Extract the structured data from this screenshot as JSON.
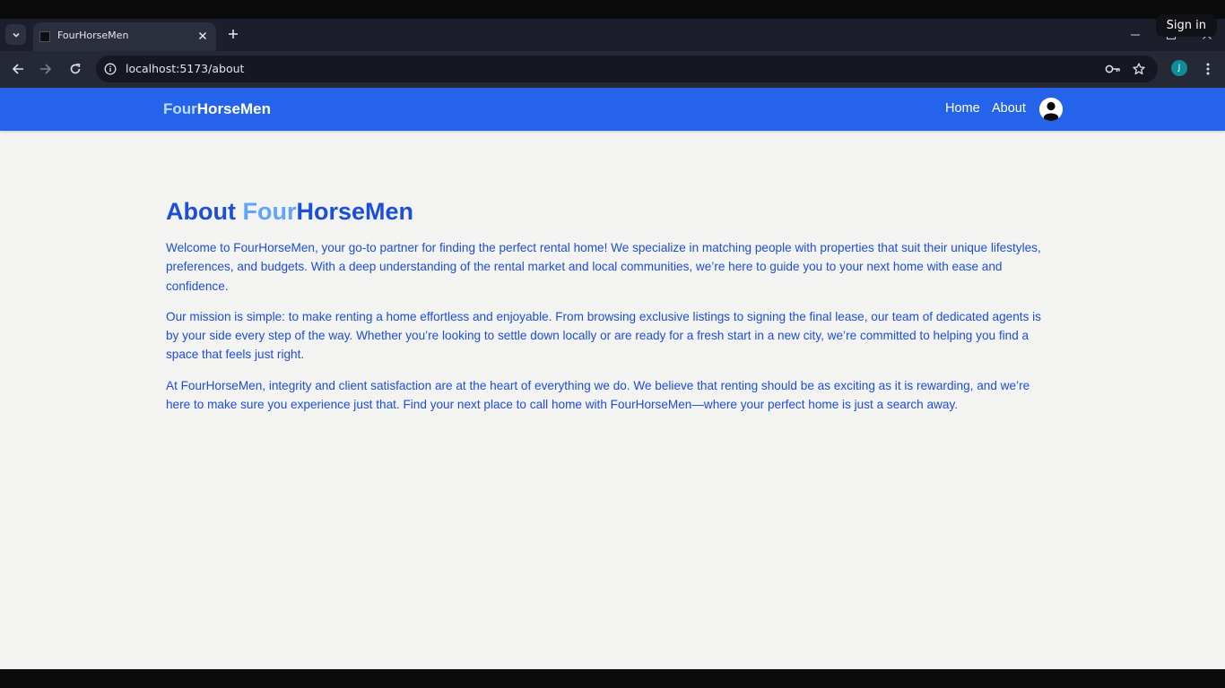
{
  "browser": {
    "tab_title": "FourHorseMen",
    "url": "localhost:5173/about",
    "profile_initial": "J",
    "sign_in_label": "Sign in",
    "icons": {
      "tab_search": "chevron-down-icon",
      "tab_close": "close-icon",
      "new_tab": "plus-icon",
      "back": "arrow-left-icon",
      "forward": "arrow-right-icon",
      "reload": "reload-icon",
      "site_info": "info-icon",
      "password": "key-icon",
      "bookmark": "star-icon",
      "menu": "kebab-menu-icon"
    }
  },
  "navbar": {
    "brand_part1": "Four",
    "brand_part2": "HorseMen",
    "links": [
      "Home",
      "About"
    ],
    "avatar_icon": "user-avatar-icon"
  },
  "about": {
    "title_prefix": "About ",
    "title_highlight": "Four",
    "title_rest": "HorseMen",
    "paragraphs": [
      "Welcome to FourHorseMen, your go-to partner for finding the perfect rental home! We specialize in matching people with properties that suit their unique lifestyles, preferences, and budgets. With a deep understanding of the rental market and local communities, we’re here to guide you to your next home with ease and confidence.",
      "Our mission is simple: to make renting a home effortless and enjoyable. From browsing exclusive listings to signing the final lease, our team of dedicated agents is by your side every step of the way. Whether you’re looking to settle down locally or are ready for a fresh start in a new city, we’re committed to helping you find a space that feels just right.",
      "At FourHorseMen, integrity and client satisfaction are at the heart of everything we do. We believe that renting should be as exciting as it is rewarding, and we’re here to make sure you experience just that. Find your next place to call home with FourHorseMen—where your perfect home is just a search away."
    ]
  },
  "colors": {
    "navbar_bg": "#2563eb",
    "brand_accent": "#bfdbfe",
    "text_blue": "#1d4ed8",
    "highlight_blue": "#60a5fa",
    "page_bg": "#f3f3f2"
  }
}
